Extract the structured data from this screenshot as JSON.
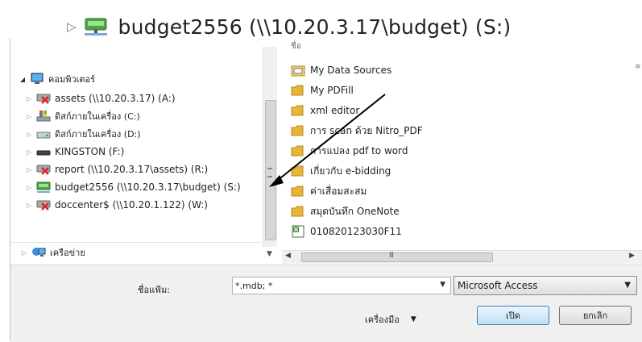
{
  "banner": {
    "label": "budget2556 (\\\\10.20.3.17\\budget) (S:)"
  },
  "nav": {
    "computer_label": "คอมพิวเตอร์",
    "items": [
      {
        "label": "assets (\\\\10.20.3.17) (A:)",
        "icon": "disconnected-network-drive-icon"
      },
      {
        "label": "ดิสก์ภายในเครื่อง (C:)",
        "icon": "windows-drive-icon"
      },
      {
        "label": "ดิสก์ภายในเครื่อง (D:)",
        "icon": "hard-drive-icon"
      },
      {
        "label": "KINGSTON (F:)",
        "icon": "usb-drive-icon"
      },
      {
        "label": "report (\\\\10.20.3.17\\assets) (R:)",
        "icon": "disconnected-network-drive-icon"
      },
      {
        "label": "budget2556 (\\\\10.20.3.17\\budget) (S:)",
        "icon": "network-drive-icon"
      },
      {
        "label": "doccenter$ (\\\\10.20.1.122) (W:)",
        "icon": "disconnected-network-drive-icon"
      }
    ],
    "network_label": "เครือข่าย"
  },
  "files": {
    "column_header": "ชื่อ",
    "items": [
      {
        "label": "My Data Sources",
        "icon": "data-source-folder-icon"
      },
      {
        "label": "My PDFill",
        "icon": "folder-icon"
      },
      {
        "label": "xml editor",
        "icon": "folder-icon"
      },
      {
        "label": "การ scan ด้วย Nitro_PDF",
        "icon": "folder-icon"
      },
      {
        "label": "การแปลง pdf to word",
        "icon": "folder-icon"
      },
      {
        "label": "เกี่ยวกับ e-bidding",
        "icon": "folder-icon"
      },
      {
        "label": "ค่าเสื่อมสะสม",
        "icon": "folder-icon"
      },
      {
        "label": "สมุดบันทึก OneNote",
        "icon": "folder-icon"
      },
      {
        "label": "010820123030F11",
        "icon": "excel-file-icon"
      }
    ]
  },
  "scroll": {
    "grip": "III"
  },
  "footer": {
    "filename_label": "ชื่อแฟ้ม:",
    "filename_value": "*.mdb; *",
    "filetype_value": "Microsoft Access",
    "tools_label": "เครื่องมือ",
    "open_label": "เปิด",
    "cancel_label": "ยกเลิก"
  },
  "colors": {
    "folder": "#e8b53a",
    "accent": "#3c7fb1",
    "annotation": "#000000"
  }
}
